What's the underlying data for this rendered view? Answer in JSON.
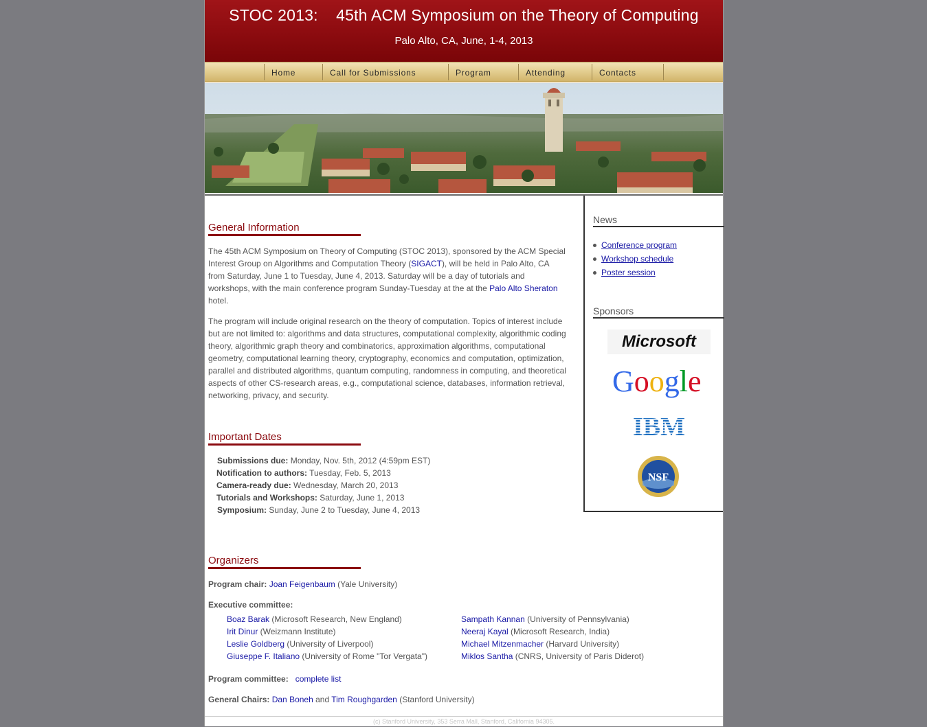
{
  "header": {
    "title": "STOC 2013:    45th ACM Symposium on the Theory of Computing",
    "subtitle": "Palo Alto, CA, June, 1-4, 2013"
  },
  "nav": {
    "items": [
      {
        "label": "Home"
      },
      {
        "label": "Call for Submissions"
      },
      {
        "label": "Program"
      },
      {
        "label": "Attending"
      },
      {
        "label": "Contacts"
      }
    ]
  },
  "general": {
    "title": "General Information",
    "p1_a": "The 45th ACM Symposium on Theory of Computing (STOC 2013), sponsored by the ACM Special Interest Group on Algorithms and Computation Theory (",
    "p1_link1": "SIGACT",
    "p1_b": "), will be held in Palo Alto, CA from Saturday, June 1 to Tuesday, June 4, 2013. Saturday will be a day of tutorials and workshops, with the main conference program Sunday-Tuesday at the at the ",
    "p1_link2": "Palo Alto Sheraton",
    "p1_c": " hotel.",
    "p2": "The program will include original research on the theory of computation. Topics of interest include but are not limited to: algorithms and data structures, computational complexity, algorithmic coding theory, algorithmic graph theory and combinatorics, approximation algorithms, computational geometry, computational learning theory, cryptography, economics and computation, optimization, parallel and distributed algorithms, quantum computing, randomness in computing, and theoretical aspects of other CS-research areas, e.g., computational science, databases, information retrieval, networking, privacy, and security."
  },
  "dates": {
    "title": "Important Dates",
    "rows": [
      {
        "label": "Submissions due:",
        "value": " Monday, Nov. 5th, 2012 (4:59pm EST)"
      },
      {
        "label": "Notification to authors:",
        "value": " Tuesday, Feb. 5, 2013"
      },
      {
        "label": "Camera-ready due:",
        "value": " Wednesday, March 20, 2013"
      },
      {
        "label": "Tutorials and Workshops:",
        "value": " Saturday, June 1, 2013"
      },
      {
        "label": "Symposium:",
        "value": " Sunday, June 2 to Tuesday, June 4, 2013"
      }
    ]
  },
  "organizers": {
    "title": "Organizers",
    "program_chair_label": "Program chair:",
    "program_chair_name": "Joan Feigenbaum",
    "program_chair_affil": " (Yale University)",
    "exec_label": "Executive committee:",
    "exec_left": [
      {
        "name": "Boaz Barak",
        "affil": " (Microsoft Research, New England)"
      },
      {
        "name": "Irit Dinur",
        "affil": " (Weizmann Institute)"
      },
      {
        "name": "Leslie Goldberg",
        "affil": " (University of Liverpool)"
      },
      {
        "name": "Giuseppe F. Italiano",
        "affil": " (University of Rome \"Tor Vergata\")"
      }
    ],
    "exec_right": [
      {
        "name": "Sampath Kannan",
        "affil": " (University of Pennsylvania)"
      },
      {
        "name": "Neeraj Kayal",
        "affil": " (Microsoft Research, India)"
      },
      {
        "name": "Michael Mitzenmacher",
        "affil": " (Harvard University)"
      },
      {
        "name": "Miklos Santha",
        "affil": " (CNRS, University of Paris Diderot)"
      }
    ],
    "pc_label": "Program committee:",
    "pc_link": "complete list",
    "gc_label": "General Chairs:",
    "gc_name1": "Dan Boneh",
    "gc_and": " and ",
    "gc_name2": "Tim Roughgarden",
    "gc_affil": " (Stanford University)"
  },
  "sidebar": {
    "news_title": "News",
    "news": [
      "Conference program",
      "Workshop schedule",
      "Poster session"
    ],
    "sponsors_title": "Sponsors",
    "sponsors": [
      "Microsoft",
      "Google",
      "IBM",
      "NSF"
    ]
  },
  "footer": "(c) Stanford University, 353 Serra Mall, Stanford, California 94305."
}
